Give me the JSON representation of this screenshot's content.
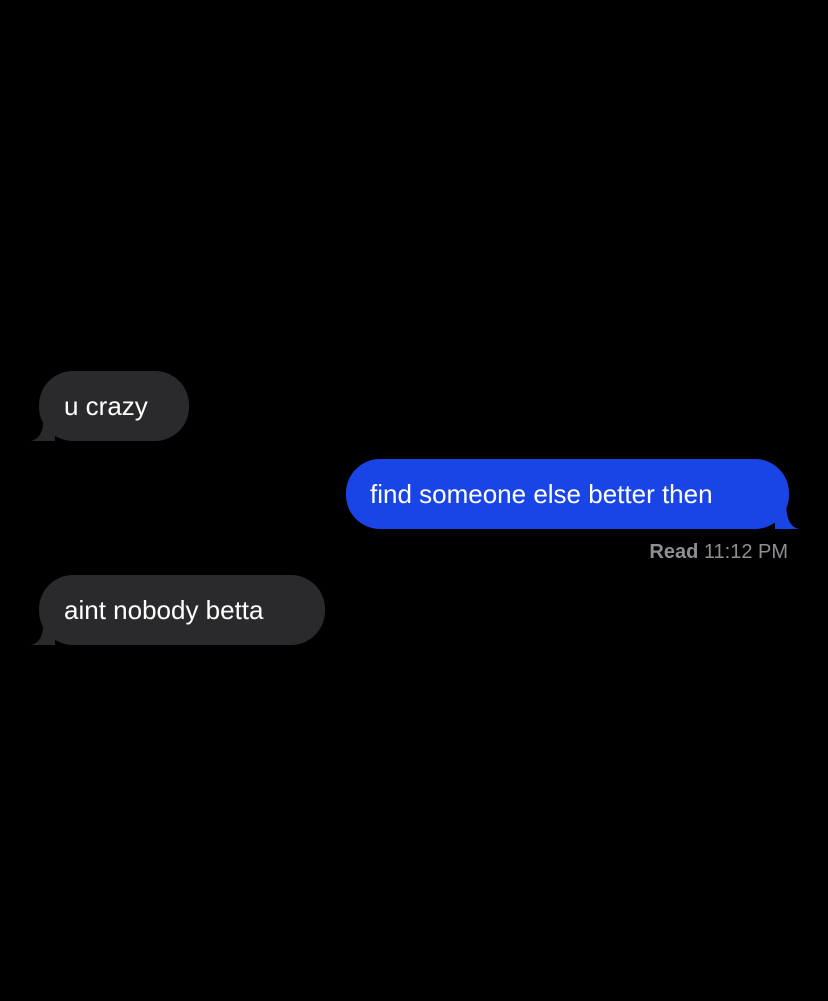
{
  "messages": [
    {
      "direction": "incoming",
      "text": "u crazy"
    },
    {
      "direction": "outgoing",
      "text": "find someone else better then"
    },
    {
      "direction": "incoming",
      "text": "aint nobody betta"
    }
  ],
  "receipt": {
    "label": "Read",
    "time": "11:12 PM"
  },
  "colors": {
    "background": "#000000",
    "incoming_bubble": "#2a2a2c",
    "outgoing_bubble": "#1a45e6",
    "receipt_text": "#8e8e93"
  }
}
